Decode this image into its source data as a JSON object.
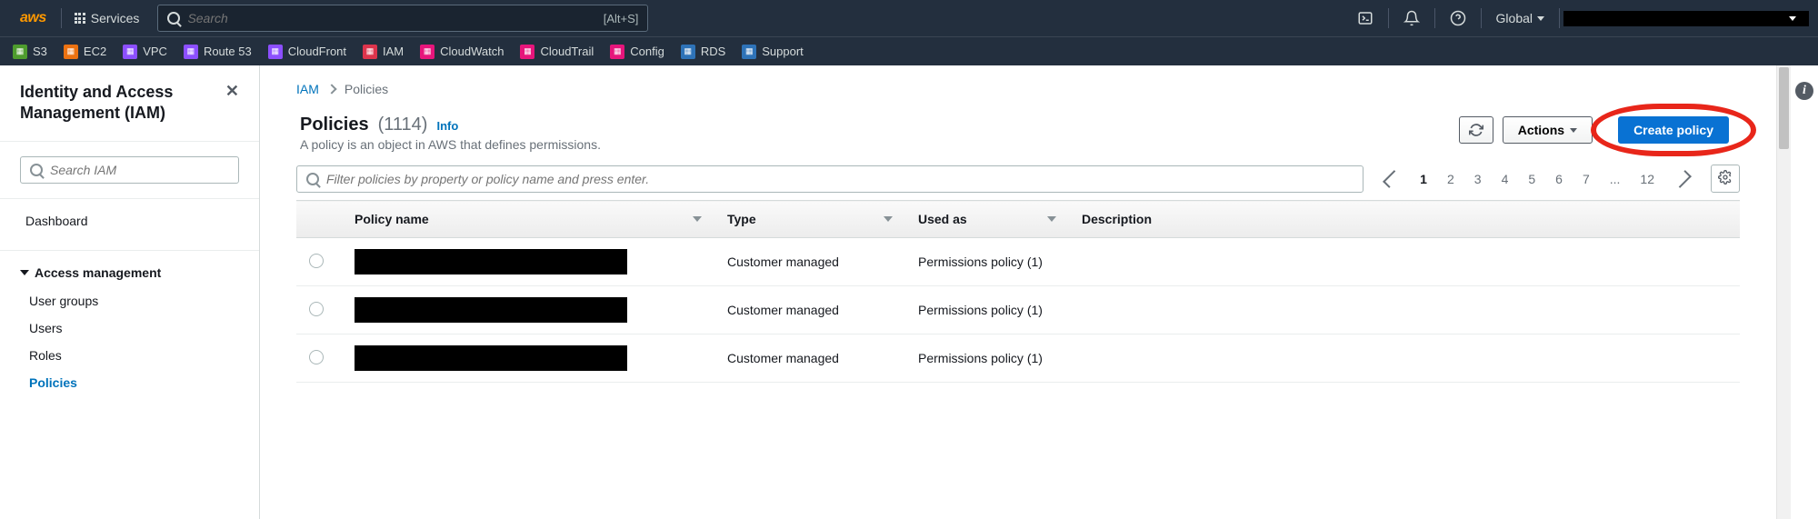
{
  "header": {
    "logo_text": "aws",
    "services_label": "Services",
    "search_placeholder": "Search",
    "search_shortcut": "[Alt+S]",
    "region_label": "Global",
    "account_label": ""
  },
  "favorites": [
    {
      "label": "S3",
      "color": "#4e9c2e"
    },
    {
      "label": "EC2",
      "color": "#ec7211"
    },
    {
      "label": "VPC",
      "color": "#8C4FFF"
    },
    {
      "label": "Route 53",
      "color": "#8C4FFF"
    },
    {
      "label": "CloudFront",
      "color": "#8C4FFF"
    },
    {
      "label": "IAM",
      "color": "#dd344c"
    },
    {
      "label": "CloudWatch",
      "color": "#e7157b"
    },
    {
      "label": "CloudTrail",
      "color": "#e7157b"
    },
    {
      "label": "Config",
      "color": "#e7157b"
    },
    {
      "label": "RDS",
      "color": "#2e73b8"
    },
    {
      "label": "Support",
      "color": "#2e73b8"
    }
  ],
  "sidebar": {
    "title": "Identity and Access Management (IAM)",
    "search_placeholder": "Search IAM",
    "dashboard_label": "Dashboard",
    "section_access": "Access management",
    "items": {
      "user_groups": "User groups",
      "users": "Users",
      "roles": "Roles",
      "policies": "Policies"
    }
  },
  "breadcrumb": {
    "root": "IAM",
    "current": "Policies"
  },
  "page": {
    "title": "Policies",
    "count": "(1114)",
    "info_label": "Info",
    "description": "A policy is an object in AWS that defines permissions.",
    "actions_label": "Actions",
    "create_label": "Create policy",
    "filter_placeholder": "Filter policies by property or policy name and press enter."
  },
  "pager": {
    "pages": [
      "1",
      "2",
      "3",
      "4",
      "5",
      "6",
      "7",
      "...",
      "12"
    ],
    "current": "1"
  },
  "table": {
    "columns": {
      "policy_name": "Policy name",
      "type": "Type",
      "used_as": "Used as",
      "description": "Description"
    },
    "rows": [
      {
        "name": "",
        "type": "Customer managed",
        "used_as": "Permissions policy (1)",
        "description": ""
      },
      {
        "name": "",
        "type": "Customer managed",
        "used_as": "Permissions policy (1)",
        "description": ""
      },
      {
        "name": "",
        "type": "Customer managed",
        "used_as": "Permissions policy (1)",
        "description": ""
      }
    ]
  }
}
